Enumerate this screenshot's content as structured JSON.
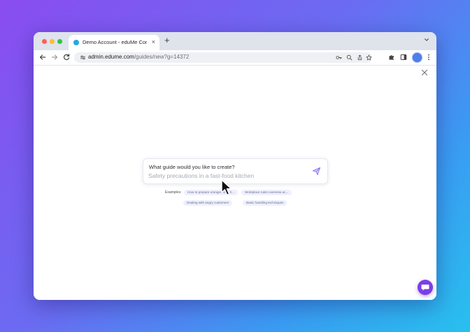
{
  "browser": {
    "tab_title": "Demo Account - eduMe Conte",
    "tab_close": "×",
    "new_tab": "+",
    "url_domain": "admin.edume.com",
    "url_path": "/guides/new?g=14372"
  },
  "prompt": {
    "label": "What guide would you like to create?",
    "placeholder": "Safety precautions in a fast-food kitchen"
  },
  "examples": {
    "label": "Examples:",
    "chips": [
      "How to prepare oranges for a lr...",
      "Workplace rules overview ac...",
      "Dealing with angry customers",
      "Basic handling techniques"
    ]
  },
  "colors": {
    "accent": "#7b3fe4",
    "send_icon": "#8a6cf0",
    "chip_bg": "#eef0ff",
    "background_start": "#8a4cf0",
    "background_end": "#28c0ee"
  },
  "icons": {
    "tab_favicon": "edume-favicon-icon",
    "chat": "chat-bubble-icon",
    "send": "paper-plane-send-icon",
    "close": "close-icon",
    "cursor": "mouse-pointer-icon"
  }
}
